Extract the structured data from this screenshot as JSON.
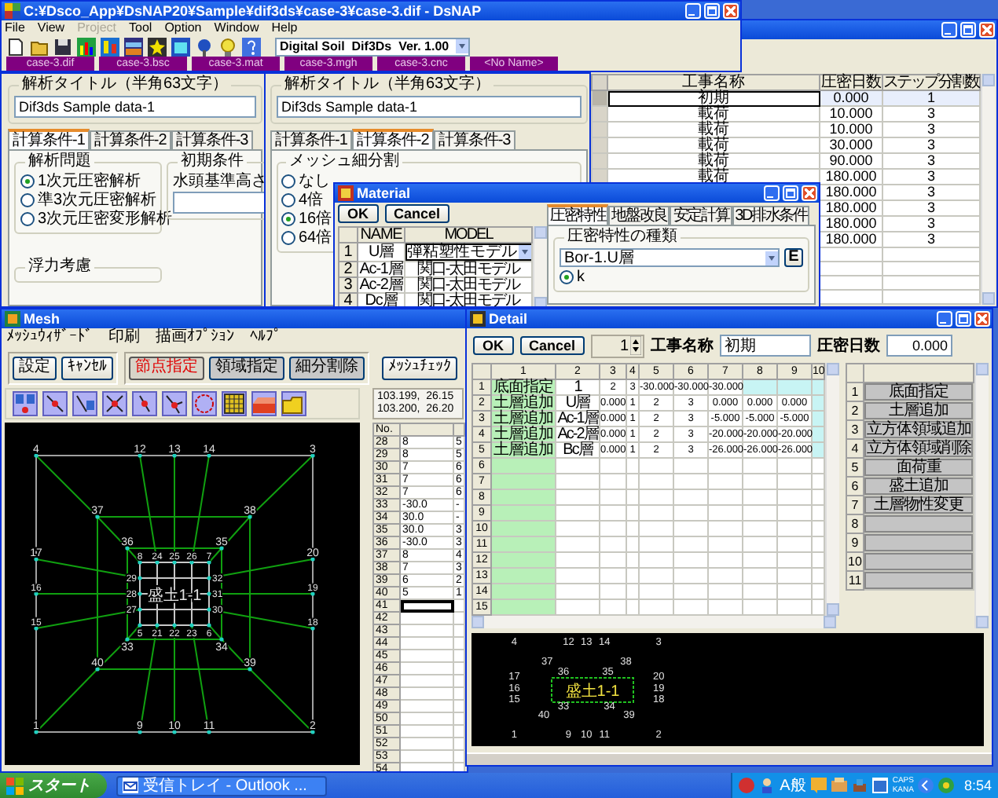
{
  "main_window": {
    "title": "C:¥Dsco_App¥DsNAP20¥Sample¥dif3ds¥case-3¥case-3.dif - DsNAP",
    "menu": [
      {
        "label": "File",
        "disabled": false
      },
      {
        "label": "View",
        "disabled": false
      },
      {
        "label": "Project",
        "disabled": true
      },
      {
        "label": "Tool",
        "disabled": false
      },
      {
        "label": "Option",
        "disabled": false
      },
      {
        "label": "Window",
        "disabled": false
      },
      {
        "label": "Help",
        "disabled": false
      }
    ],
    "version": "Digital Soil  Dif3Ds  Ver. 1.00",
    "doc_tabs": [
      "case-3.dif",
      "case-3.bsc",
      "case-3.mat",
      "case-3.mgh",
      "case-3.cnc",
      "<No Name>"
    ]
  },
  "panels": [
    {
      "title_label": "解析タイトル（半角63文字）",
      "title_value": "Dif3ds Sample data-1",
      "tabs": [
        {
          "label": "計算条件-1",
          "selected": true
        },
        {
          "label": "計算条件-2",
          "selected": false
        },
        {
          "label": "計算条件-3",
          "selected": false
        }
      ],
      "groups": [
        {
          "kind": "radios",
          "title": "解析問題",
          "options": [
            {
              "label": "1次元圧密解析",
              "selected": true
            },
            {
              "label": "準3次元圧密解析",
              "selected": false
            },
            {
              "label": "3次元圧密変形解析",
              "selected": false
            }
          ]
        },
        {
          "kind": "field",
          "title": "初期条件",
          "label": "水頭基準高さ"
        },
        {
          "kind": "empty",
          "title": "浮力考慮"
        }
      ]
    },
    {
      "title_label": "解析タイトル（半角63文字）",
      "title_value": "Dif3ds Sample data-1",
      "tabs": [
        {
          "label": "計算条件-1",
          "selected": false
        },
        {
          "label": "計算条件-2",
          "selected": true
        },
        {
          "label": "計算条件-3",
          "selected": false
        }
      ],
      "groups": [
        {
          "kind": "radios",
          "title": "メッシュ細分割",
          "options": [
            {
              "label": "なし",
              "selected": false
            },
            {
              "label": "4倍",
              "selected": false
            },
            {
              "label": "16倍",
              "selected": true
            },
            {
              "label": "64倍",
              "selected": false
            }
          ]
        }
      ]
    }
  ],
  "schedule": {
    "columns": [
      "工事名称",
      "圧密日数",
      "ステップ分割数"
    ],
    "rows": [
      {
        "name": "初期",
        "days": "0.000",
        "steps": "1",
        "selected": true
      },
      {
        "name": "載荷",
        "days": "10.000",
        "steps": "3",
        "selected": false
      },
      {
        "name": "載荷",
        "days": "10.000",
        "steps": "3",
        "selected": false
      },
      {
        "name": "載荷",
        "days": "30.000",
        "steps": "3",
        "selected": false
      },
      {
        "name": "載荷",
        "days": "90.000",
        "steps": "3",
        "selected": false
      },
      {
        "name": "載荷",
        "days": "180.000",
        "steps": "3",
        "selected": false
      },
      {
        "days": "180.000",
        "steps": "3",
        "selected": false
      },
      {
        "days": "180.000",
        "steps": "3",
        "selected": false
      },
      {
        "days": "180.000",
        "steps": "3",
        "selected": false
      },
      {
        "days": "180.000",
        "steps": "3",
        "selected": false
      }
    ]
  },
  "material": {
    "title": "Material",
    "buttons": [
      "OK",
      "Cancel"
    ],
    "columns": [
      "NAME",
      "MODEL"
    ],
    "rows": [
      {
        "no": "1",
        "name": "U層",
        "model": "弾粘塑性モデル",
        "selected": true
      },
      {
        "no": "2",
        "name": "Ac-1層",
        "model": "関口-太田モデル",
        "selected": false
      },
      {
        "no": "3",
        "name": "Ac-2層",
        "model": "関口-太田モデル",
        "selected": false
      },
      {
        "no": "4",
        "name": "Dc層",
        "model": "関口-太田モデル",
        "selected": false
      }
    ],
    "tabs": [
      {
        "label": "圧密特性",
        "selected": true
      },
      {
        "label": "地盤改良",
        "selected": false
      },
      {
        "label": "安定計算",
        "selected": false
      },
      {
        "label": "3D排水条件",
        "selected": false
      }
    ],
    "group_title": "圧密特性の種類",
    "type_value": "Bor-1.U層",
    "edit_button": "E",
    "radio": {
      "label": "k",
      "selected": true
    }
  },
  "mesh": {
    "title": "Mesh",
    "menu": [
      "ﾒｯｼｭｳｨｻﾞｰﾄﾞ",
      "印刷",
      "描画ｵﾌﾟｼｮﾝ",
      "ﾍﾙﾌﾟ"
    ],
    "action_buttons": [
      "設定",
      "ｷｬﾝｾﾙ"
    ],
    "mode_buttons": [
      {
        "label": "節点指定",
        "selected": true
      },
      {
        "label": "領域指定",
        "selected": false
      },
      {
        "label": "細分割除",
        "selected": false
      }
    ],
    "check_button": "ﾒｯｼｭﾁｪｯｸ",
    "coords": [
      "103.199,  26.15",
      "103.200,  26.20"
    ],
    "node_labels": [
      "4",
      "12",
      "13",
      "14",
      "3",
      "37",
      "38",
      "36",
      "35",
      "17",
      "20",
      "8",
      "24",
      "25",
      "26",
      "7",
      "29",
      "32",
      "16",
      "28",
      "31",
      "19",
      "27",
      "30",
      "15",
      "18",
      "5",
      "21",
      "22",
      "23",
      "6",
      "33",
      "34",
      "40",
      "39",
      "1",
      "9",
      "10",
      "11",
      "2"
    ],
    "region_label": "盛土1-1",
    "table": {
      "header": "No.",
      "rows": [
        {
          "no": "28",
          "cells": [
            "8",
            "5"
          ],
          "selected": false
        },
        {
          "no": "29",
          "cells": [
            "8",
            "5"
          ],
          "selected": false
        },
        {
          "no": "30",
          "cells": [
            "7",
            "6"
          ],
          "selected": false
        },
        {
          "no": "31",
          "cells": [
            "7",
            "6"
          ],
          "selected": false
        },
        {
          "no": "32",
          "cells": [
            "7",
            "6"
          ],
          "selected": false
        },
        {
          "no": "33",
          "cells": [
            "-30.0",
            "-"
          ],
          "selected": false
        },
        {
          "no": "34",
          "cells": [
            "30.0",
            "-"
          ],
          "selected": false
        },
        {
          "no": "35",
          "cells": [
            "30.0",
            "3"
          ],
          "selected": false
        },
        {
          "no": "36",
          "cells": [
            "-30.0",
            "3"
          ],
          "selected": false
        },
        {
          "no": "37",
          "cells": [
            "8",
            "4"
          ],
          "selected": false
        },
        {
          "no": "38",
          "cells": [
            "7",
            "3"
          ],
          "selected": false
        },
        {
          "no": "39",
          "cells": [
            "6",
            "2"
          ],
          "selected": false
        },
        {
          "no": "40",
          "cells": [
            "5",
            "1"
          ],
          "selected": false
        },
        {
          "no": "41",
          "cells": [],
          "selected": true
        },
        {
          "no": "42",
          "cells": [],
          "selected": false
        },
        {
          "no": "43",
          "cells": [],
          "selected": false
        },
        {
          "no": "44",
          "cells": [],
          "selected": false
        },
        {
          "no": "45",
          "cells": [],
          "selected": false
        },
        {
          "no": "46",
          "cells": [],
          "selected": false
        },
        {
          "no": "47",
          "cells": [],
          "selected": false
        },
        {
          "no": "48",
          "cells": [],
          "selected": false
        },
        {
          "no": "49",
          "cells": [],
          "selected": false
        },
        {
          "no": "50",
          "cells": [],
          "selected": false
        },
        {
          "no": "51",
          "cells": [],
          "selected": false
        },
        {
          "no": "52",
          "cells": [],
          "selected": false
        },
        {
          "no": "53",
          "cells": [],
          "selected": false
        },
        {
          "no": "54",
          "cells": [],
          "selected": false
        }
      ]
    }
  },
  "detail": {
    "title": "Detail",
    "buttons": [
      "OK",
      "Cancel"
    ],
    "step": "1",
    "name_label": "工事名称",
    "name_value": "初期",
    "days_label": "圧密日数",
    "days_value": "0.000",
    "grid": {
      "columns": [
        "1",
        "2",
        "3",
        "4",
        "5",
        "6",
        "7",
        "8",
        "9",
        "10"
      ],
      "rows": [
        {
          "no": "1",
          "cells": [
            "底面指定",
            "1",
            "2",
            "3",
            "-30.000",
            "-30.000",
            "-30.000"
          ]
        },
        {
          "no": "2",
          "cells": [
            "土層追加",
            "U層",
            "0.000",
            "1",
            "2",
            "3",
            "0.000",
            "0.000",
            "0.000"
          ]
        },
        {
          "no": "3",
          "cells": [
            "土層追加",
            "Ac-1層",
            "0.000",
            "1",
            "2",
            "3",
            "-5.000",
            "-5.000",
            "-5.000"
          ]
        },
        {
          "no": "4",
          "cells": [
            "土層追加",
            "Ac-2層",
            "0.000",
            "1",
            "2",
            "3",
            "-20.000",
            "-20.000",
            "-20.000"
          ]
        },
        {
          "no": "5",
          "cells": [
            "土層追加",
            "Bc層",
            "0.000",
            "1",
            "2",
            "3",
            "-26.000",
            "-26.000",
            "-26.000"
          ]
        },
        {
          "no": "6",
          "cells": []
        },
        {
          "no": "7",
          "cells": []
        },
        {
          "no": "8",
          "cells": []
        },
        {
          "no": "9",
          "cells": []
        },
        {
          "no": "10",
          "cells": []
        },
        {
          "no": "11",
          "cells": []
        },
        {
          "no": "12",
          "cells": []
        },
        {
          "no": "13",
          "cells": []
        },
        {
          "no": "14",
          "cells": []
        },
        {
          "no": "15",
          "cells": []
        }
      ]
    },
    "commands": [
      {
        "no": "1",
        "label": "底面指定"
      },
      {
        "no": "2",
        "label": "土層追加"
      },
      {
        "no": "3",
        "label": "立方体領域追加"
      },
      {
        "no": "4",
        "label": "立方体領域削除"
      },
      {
        "no": "5",
        "label": "面荷重"
      },
      {
        "no": "6",
        "label": "盛土追加"
      },
      {
        "no": "7",
        "label": "土層物性変更"
      },
      {
        "no": "8"
      },
      {
        "no": "9"
      },
      {
        "no": "10"
      },
      {
        "no": "11"
      }
    ],
    "node_labels": [
      "4",
      "12",
      "13",
      "14",
      "3",
      "37",
      "38",
      "17",
      "36",
      "35",
      "20",
      "16",
      "19",
      "15",
      "33",
      "34",
      "18",
      "40",
      "39",
      "1",
      "9",
      "10",
      "11",
      "2"
    ],
    "region_label": "盛土1-1"
  },
  "taskbar": {
    "start": "スタート",
    "tasks": [
      {
        "label": "受信トレイ - Outlook ...",
        "selected": false
      }
    ],
    "ime": "A般",
    "locks": [
      "CAPS",
      "KANA"
    ],
    "clock": "8:54"
  }
}
